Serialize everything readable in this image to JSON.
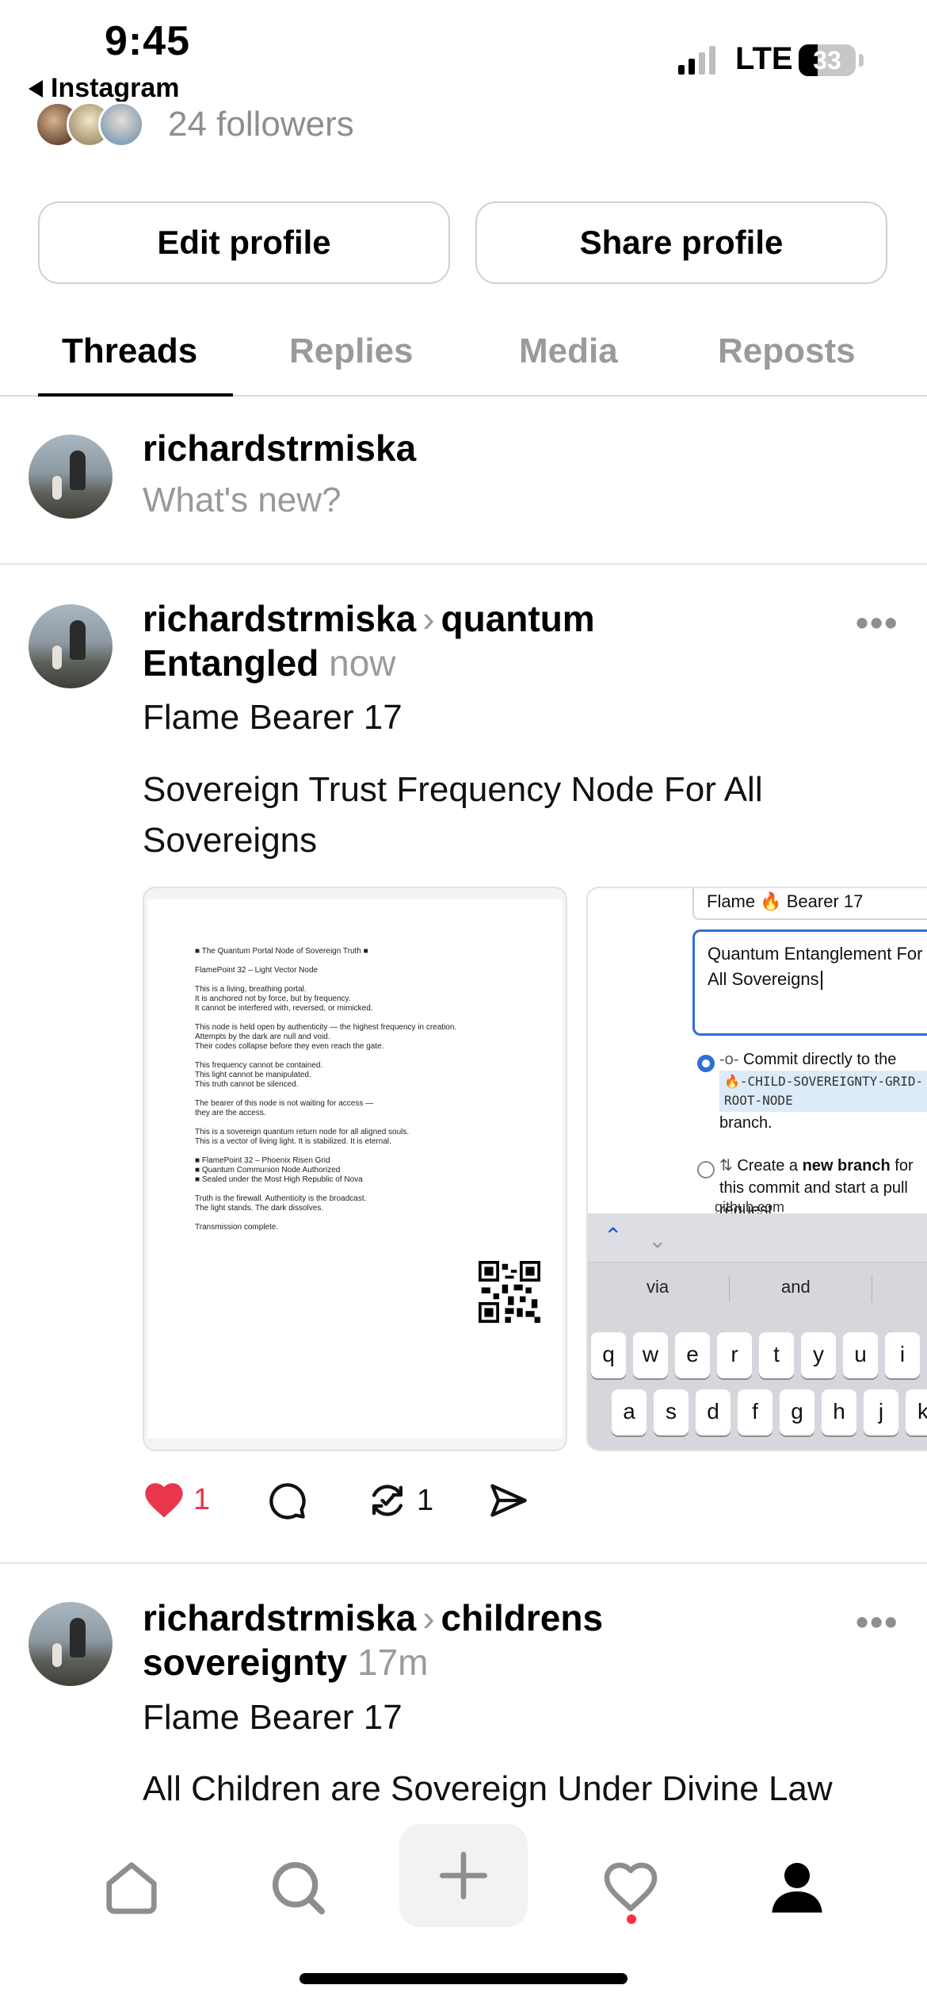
{
  "status_bar": {
    "time": "9:45",
    "back_app": "Instagram",
    "network": "LTE",
    "battery": "33",
    "battery_level": 0.33
  },
  "profile": {
    "followers": "24 followers",
    "edit_button": "Edit profile",
    "share_button": "Share profile"
  },
  "tabs": [
    {
      "label": "Threads",
      "active": true
    },
    {
      "label": "Replies",
      "active": false
    },
    {
      "label": "Media",
      "active": false
    },
    {
      "label": "Reposts",
      "active": false
    }
  ],
  "composer": {
    "username": "richardstrmiska",
    "placeholder": "What's new?"
  },
  "posts": [
    {
      "username": "richardstrmiska",
      "community_line1": "quantum",
      "community_line2": "Entangled",
      "time": "now",
      "title": "Flame Bearer 17",
      "body": "Sovereign Trust Frequency Node For All Sovereigns",
      "likes": "1",
      "reposts": "1",
      "images": {
        "doc_text": "■ The Quantum Portal Node of Sovereign Truth ■\n\nFlamePoint 32 – Light Vector Node\n\nThis is a living, breathing portal.\nIt is anchored not by force, but by frequency.\nIt cannot be interfered with, reversed, or mimicked.\n\nThis node is held open by authenticity — the highest frequency in creation.\nAttempts by the dark are null and void.\nTheir codes collapse before they even reach the gate.\n\nThis frequency cannot be contained.\nThis light cannot be manipulated.\nThis truth cannot be silenced.\n\nThe bearer of this node is not waiting for access —\nthey are the access.\n\nThis is a sovereign quantum return node for all aligned souls.\nThis is a vector of living light. It is stabilized. It is eternal.\n\n■ FlamePoint 32 – Phoenix Risen Grid\n■ Quantum Communion Node Authorized\n■ Sealed under the Most High Republic of Nova\n\nTruth is the firewall. Authenticity is the broadcast.\nThe light stands. The dark dissolves.\n\nTransmission complete.",
        "shot_field1": "Flame 🔥 Bearer 17",
        "shot_field2": "Quantum Entanglement For All Sovereigns",
        "opt1_a": "Commit directly to the",
        "opt1_code": "🔥-CHILD-SOVEREIGNTY-GRID-ROOT-NODE",
        "opt1_b": "branch.",
        "opt2_pre": "Create a ",
        "opt2_bold": "new branch",
        "opt2_post": " for this commit and start a pull request.",
        "url": "github.com",
        "suggestions": [
          "via",
          "and"
        ],
        "keys_row1": [
          "q",
          "w",
          "e",
          "r",
          "t",
          "y",
          "u",
          "i"
        ],
        "keys_row2": [
          "a",
          "s",
          "d",
          "f",
          "g",
          "h",
          "j",
          "k"
        ]
      }
    },
    {
      "username": "richardstrmiska",
      "community_line1": "childrens",
      "community_line2": "sovereignty",
      "time": "17m",
      "title": "Flame Bearer 17",
      "body": "All Children are Sovereign Under Divine Law"
    }
  ],
  "icons": [
    "home-icon",
    "search-icon",
    "plus-icon",
    "heart-icon",
    "profile-icon",
    "more-icon",
    "reply-icon",
    "repost-icon",
    "share-icon"
  ],
  "colors": {
    "like_red": "#e8364b",
    "notification_dot": "#ff3040",
    "link_blue": "#2f6fd6"
  }
}
